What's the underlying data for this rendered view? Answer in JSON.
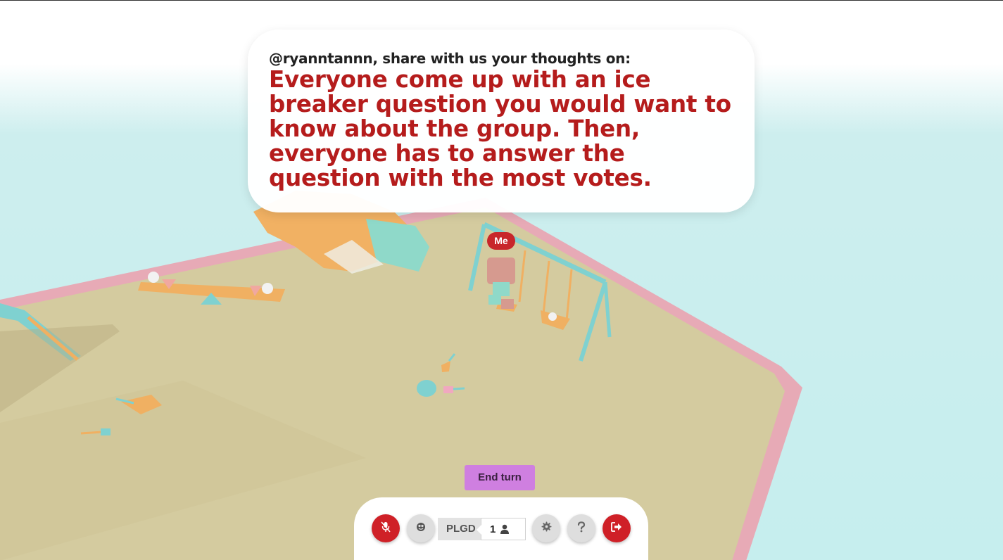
{
  "prompt": {
    "header": "@ryanntannn, share with us your thoughts on:",
    "question": "Everyone come up with an ice breaker question you would want to know about the group. Then, everyone has to answer the question with the most votes."
  },
  "player_tag": "Me",
  "end_turn_label": "End turn",
  "toolbar": {
    "room_code": "PLGD",
    "player_count": "1",
    "icons": {
      "mic": "mic-off-icon",
      "emoji": "emoji-icon",
      "players": "person-icon",
      "settings": "gear-icon",
      "help": "question-icon",
      "leave": "exit-icon"
    }
  },
  "colors": {
    "accent_red": "#cf2027",
    "question_text": "#b51c1c",
    "end_turn": "#cf7fe0",
    "sky": "#c6eeee",
    "ground": "#d4c99c",
    "border_pink": "#e9a9b7"
  }
}
